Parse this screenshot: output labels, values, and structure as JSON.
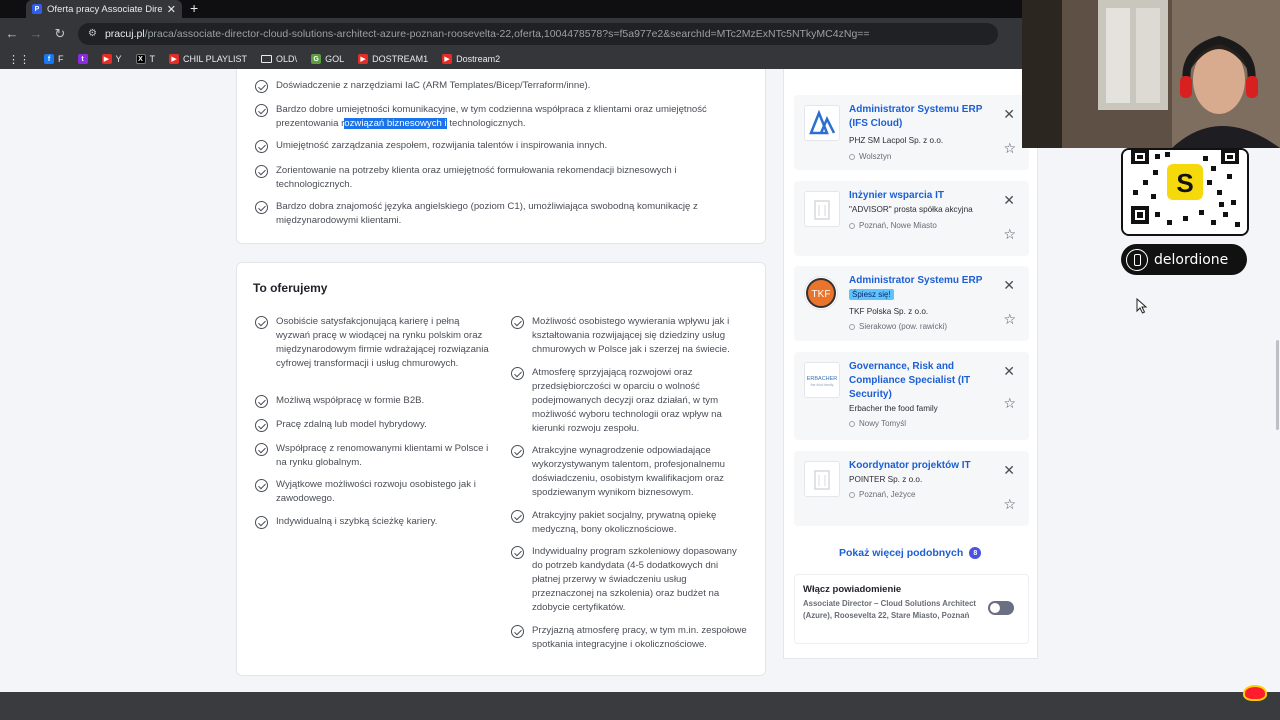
{
  "browser": {
    "tab_title": "Oferta pracy Associate Director",
    "tab_favicon": "P",
    "url_domain": "pracuj.pl",
    "url_path": "/praca/associate-director-cloud-solutions-architect-azure-poznan-roosevelta-22,oferta,1004478578?s=f5a977e2&searchId=MTc2MzExNTc5NTkyMC4zNg==",
    "bookmarks": [
      {
        "label": "F",
        "icon": "facebook-icon"
      },
      {
        "label": "",
        "icon": "twitch-icon"
      },
      {
        "label": "Y",
        "icon": "youtube-icon"
      },
      {
        "label": "T",
        "icon": "x-icon"
      },
      {
        "label": "CHIL PLAYLIST",
        "icon": "youtube-icon"
      },
      {
        "label": "OLD\\",
        "icon": "folder-icon"
      },
      {
        "label": "GOL",
        "icon": "gol-icon"
      },
      {
        "label": "DOSTREAM1",
        "icon": "youtube-icon"
      },
      {
        "label": "Dostream2",
        "icon": "youtube-icon"
      }
    ]
  },
  "requirements": {
    "items": [
      {
        "text": "Doświadczenie z narzędziami IaC (ARM Templates/Bicep/Terraform/inne)."
      },
      {
        "text_pre": "Bardzo dobre umiejętności komunikacyjne, w tym codzienna współpraca z klientami oraz umiejętność prezentowania r",
        "text_hl": "ozwiązań biznesowych i",
        "text_post": " technologicznych."
      },
      {
        "text": "Umiejętność zarządzania zespołem, rozwijania talentów i inspirowania innych."
      },
      {
        "text": "Zorientowanie na potrzeby klienta oraz umiejętność formułowania rekomendacji biznesowych i technologicznych."
      },
      {
        "text": "Bardzo dobra znajomość języka angielskiego (poziom C1), umożliwiająca swobodną komunikację z międzynarodowymi klientami."
      }
    ]
  },
  "offer": {
    "title": "To oferujemy",
    "left": [
      "Osobiście satysfakcjonującą karierę i pełną wyzwań pracę w wiodącej na rynku polskim oraz międzynarodowym firmie wdrażającej rozwiązania cyfrowej transformacji i usług chmurowych.",
      "Możliwą współpracę w formie B2B.",
      "Pracę zdalną lub model hybrydowy.",
      "Współpracę z renomowanymi klientami w Polsce i na rynku globalnym.",
      "Wyjątkowe możliwości rozwoju osobistego jak i zawodowego.",
      "Indywidualną i szybką ścieżkę kariery."
    ],
    "right": [
      "Możliwość osobistego wywierania wpływu jak i kształtowania rozwijającej się dziedziny usług chmurowych w Polsce jak i szerzej na świecie.",
      "Atmosferę sprzyjającą rozwojowi oraz przedsiębiorczości w oparciu o wolność podejmowanych decyzji oraz działań, w tym możliwość wyboru technologii oraz wpływ na kierunki rozwoju zespołu.",
      "Atrakcyjne wynagrodzenie odpowiadające wykorzystywanym talentom, profesjonalnemu doświadczeniu, osobistym kwalifikacjom oraz spodziewanym wynikom biznesowym.",
      "Atrakcyjny pakiet socjalny, prywatną opiekę medyczną, bony okolicznościowe.",
      "Indywidualny program szkoleniowy dopasowany do potrzeb kandydata (4-5 dodatkowych dni płatnej przerwy w świadczeniu usług przeznaczonej na szkolenia) oraz budżet na zdobycie certyfikatów.",
      "Przyjazną atmosferę pracy, w tym m.in. zespołowe spotkania integracyjne i okolicznościowe."
    ]
  },
  "similar_jobs": [
    {
      "title": "Administrator Systemu ERP (IFS Cloud)",
      "company": "PHZ SM Lacpol Sp. z o.o.",
      "location": "Wolsztyn",
      "badge": ""
    },
    {
      "title": "Inżynier wsparcia IT",
      "company": "\"ADVISOR\" prosta spółka akcyjna",
      "location": "Poznań, Nowe Miasto",
      "badge": ""
    },
    {
      "title": "Administrator Systemu ERP",
      "company": "TKF Polska Sp. z o.o.",
      "location": "Sierakowo (pow. rawicki)",
      "badge": "Śpiesz się!"
    },
    {
      "title": "Governance, Risk and Compliance Specialist (IT Security)",
      "company": "Erbacher the food family",
      "location": "Nowy Tomyśl",
      "badge": ""
    },
    {
      "title": "Koordynator projektów IT",
      "company": "POINTER Sp. z o.o.",
      "location": "Poznań, Jeżyce",
      "badge": ""
    }
  ],
  "show_more": {
    "label": "Pokaż więcej podobnych",
    "count": "8"
  },
  "notification": {
    "title": "Włącz powiadomienie",
    "description": "Associate Director – Cloud Solutions Architect (Azure), Roosevelta 22, Stare Miasto, Poznań",
    "enabled": false
  },
  "overlay": {
    "handle": "delordione",
    "qr_logo": "S",
    "colors": {
      "qr_yellow": "#f5d90a",
      "brand_blue": "#1c5fd4"
    }
  }
}
